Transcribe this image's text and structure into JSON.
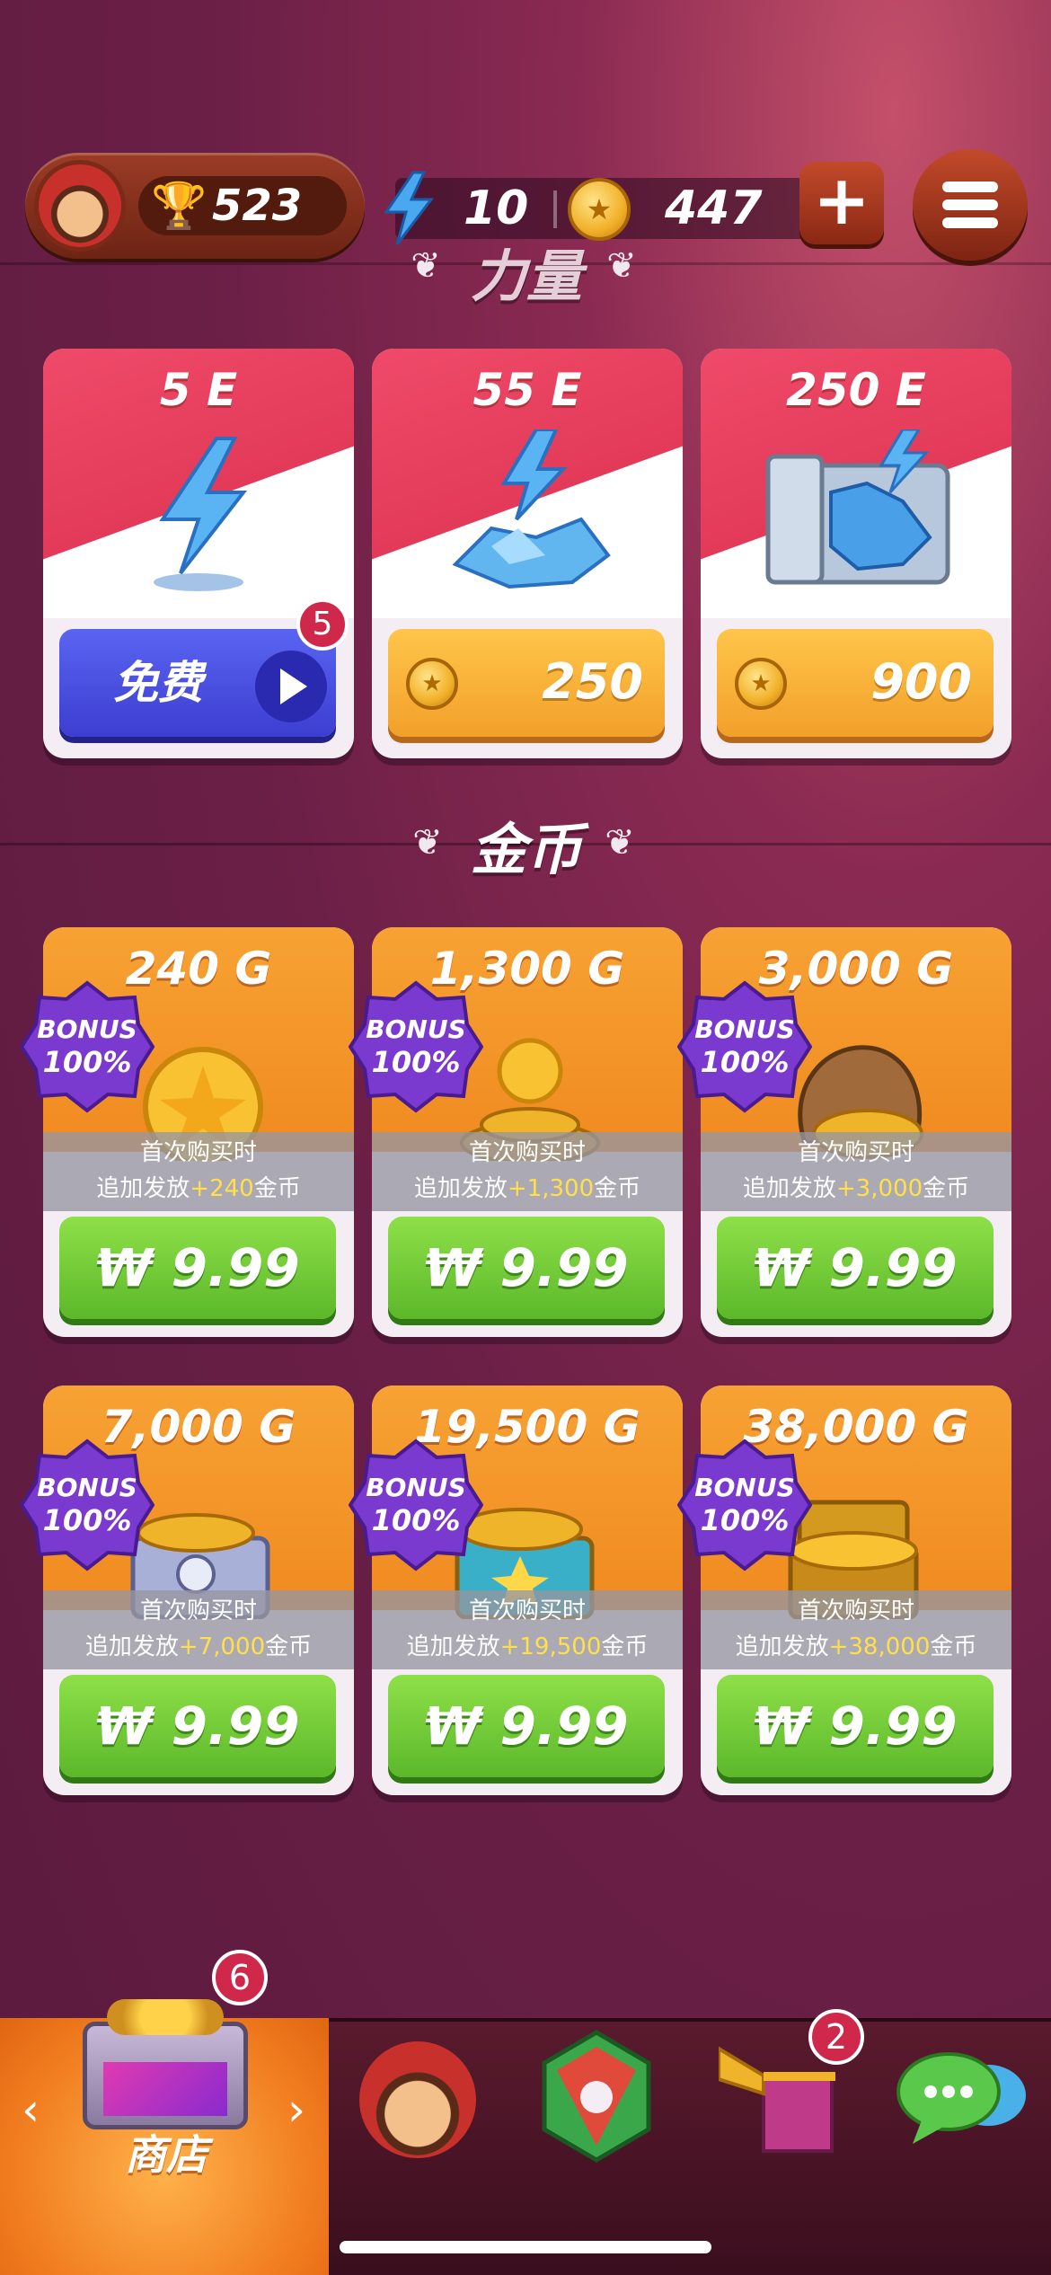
{
  "top_bar": {
    "trophy_count": "523",
    "energy": "10",
    "coins": "447"
  },
  "sections": {
    "energy_title": "力量",
    "gold_title": "金币"
  },
  "energy_items": [
    {
      "amount": "5 E",
      "button": "免费",
      "badge": "5"
    },
    {
      "amount": "55 E",
      "price": "250"
    },
    {
      "amount": "250 E",
      "price": "900"
    }
  ],
  "bonus": {
    "line1": "BONUS",
    "line2": "100%"
  },
  "first_buy": {
    "line1": "首次购买时",
    "prefix": "追加发放",
    "suffix": "金币"
  },
  "gold_items": [
    {
      "amount": "240 G",
      "extra": "+240",
      "price": "₩ 9.99"
    },
    {
      "amount": "1,300 G",
      "extra": "+1,300",
      "price": "₩ 9.99"
    },
    {
      "amount": "3,000 G",
      "extra": "+3,000",
      "price": "₩ 9.99"
    },
    {
      "amount": "7,000 G",
      "extra": "+7,000",
      "price": "₩ 9.99"
    },
    {
      "amount": "19,500 G",
      "extra": "+19,500",
      "price": "₩ 9.99"
    },
    {
      "amount": "38,000 G",
      "extra": "+38,000",
      "price": "₩ 9.99"
    }
  ],
  "bottom_nav": {
    "shop_label": "商店",
    "shop_badge": "6",
    "events_badge": "2",
    "prev_chevron": "‹",
    "next_chevron": "›"
  },
  "colors": {
    "background": "#6a1f46",
    "energy_card": "#e23a58",
    "gold_card": "#f08a20",
    "buy_green": "#5cb82a",
    "free_blue": "#3c3ed0",
    "badge_red": "#d0284a"
  },
  "icons": [
    "trophy-icon",
    "lightning-icon",
    "coin-icon",
    "plus-icon",
    "menu-icon",
    "wing-icon",
    "play-icon",
    "chest-icon",
    "gem-icon",
    "trumpet-icon",
    "chat-icon"
  ]
}
